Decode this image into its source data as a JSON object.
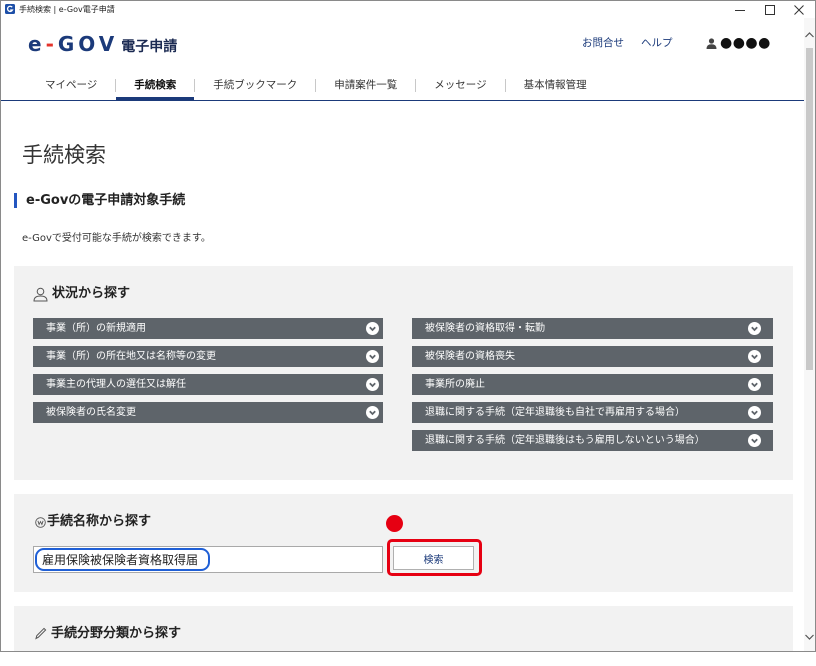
{
  "window": {
    "title": "手続検索 | e-Gov電子申請",
    "icons": {
      "app": "e-gov-app-icon",
      "minimize": "minimize-icon",
      "maximize": "maximize-icon",
      "close": "close-icon"
    }
  },
  "header": {
    "logo": {
      "e": "e",
      "dash": "-",
      "gov": "GOV"
    },
    "service_name": "電子申請",
    "contact_link": "お問合せ",
    "help_link": "ヘルプ",
    "user_icon": "person-icon",
    "user_name": "●●●●"
  },
  "nav": {
    "tabs": [
      {
        "label": "マイページ",
        "active": false
      },
      {
        "label": "手続検索",
        "active": true
      },
      {
        "label": "手続ブックマーク",
        "active": false
      },
      {
        "label": "申請案件一覧",
        "active": false
      },
      {
        "label": "メッセージ",
        "active": false
      },
      {
        "label": "基本情報管理",
        "active": false
      }
    ]
  },
  "main": {
    "page_title": "手続検索",
    "section_heading": "e-Govの電子申請対象手続",
    "description": "e-Govで受付可能な手続が検索できます。",
    "by_situation": {
      "heading": "状況から探す",
      "icon": "person-outline-icon",
      "item_icon": "chevron-down-icon",
      "left_items": [
        "事業（所）の新規適用",
        "事業（所）の所在地又は名称等の変更",
        "事業主の代理人の選任又は解任",
        "被保険者の氏名変更"
      ],
      "right_items": [
        "被保険者の資格取得・転勤",
        "被保険者の資格喪失",
        "事業所の廃止",
        "退職に関する手続（定年退職後も自社で再雇用する場合）",
        "退職に関する手続（定年退職後はもう雇用しないという場合）"
      ]
    },
    "by_name": {
      "heading": "手続名称から探す",
      "icon": "circled-w-icon",
      "input_value": "雇用保険被保険者資格取得届",
      "search_button": "検索"
    },
    "by_category": {
      "heading": "手続分野分類から探す",
      "icon": "pencil-icon"
    }
  },
  "annotations": {
    "input_highlight_color": "#1f5fd6",
    "button_highlight_color": "#e60012",
    "marker_color": "#e60012"
  },
  "colors": {
    "navy": "#1b3a7a",
    "accent_blue": "#2456c0",
    "logo_red": "#e4332b",
    "panel_bg": "#f2f2f2",
    "button_bg": "#5e646a"
  }
}
